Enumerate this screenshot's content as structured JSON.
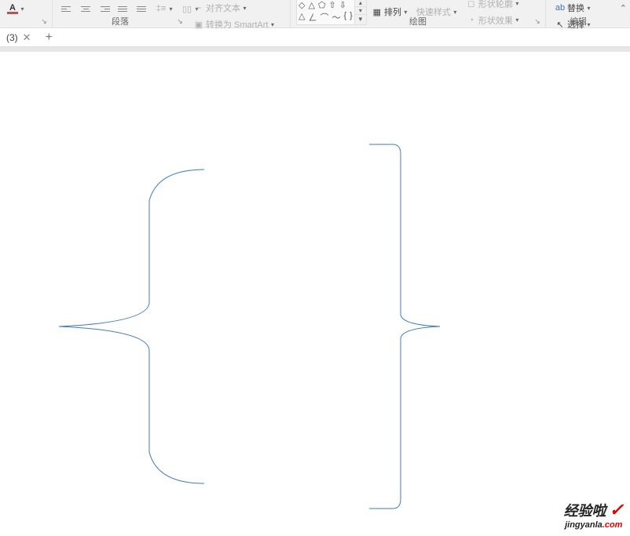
{
  "ribbon": {
    "font": {
      "letter": "A"
    },
    "paragraph": {
      "label": "段落"
    },
    "textOptions": {
      "alignText": "对齐文本",
      "convertSmartArt": "转换为 SmartArt"
    },
    "drawing": {
      "label": "绘图",
      "arrange": "排列",
      "quickStyles": "快速样式",
      "shapeOutline": "形状轮廓",
      "shapeEffects": "形状效果"
    },
    "editing": {
      "label": "编辑",
      "replace": "替换",
      "select": "选择"
    }
  },
  "tabs": {
    "itemLabel": "(3)"
  },
  "watermark": {
    "main": "经验啦",
    "sub1": "jingyanla",
    "sub2": ".com"
  }
}
